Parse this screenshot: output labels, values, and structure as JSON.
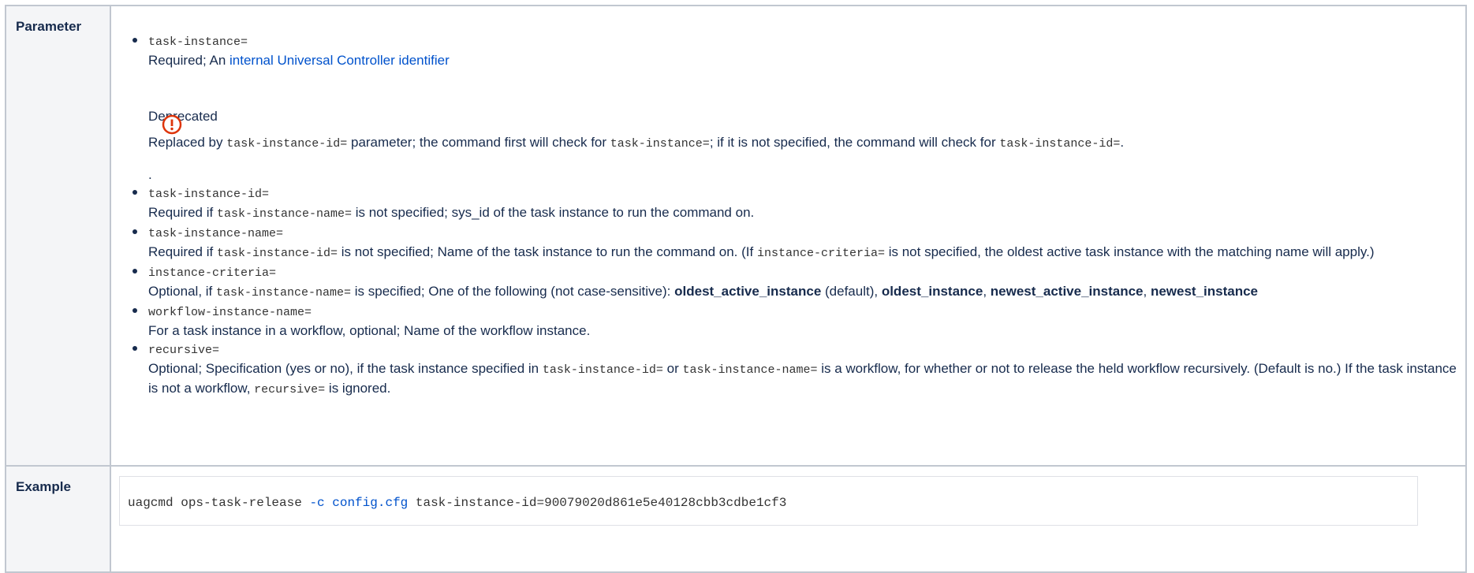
{
  "table": {
    "row1_header": "Parameter",
    "row2_header": "Example"
  },
  "params": [
    {
      "code": "task-instance=",
      "desc_pre": "Required; An ",
      "link": "internal Universal Controller identifier",
      "deprecated_title": "Deprecated",
      "deprecated": {
        "t1": "Replaced by ",
        "c1": "task-instance-id=",
        "t2": " parameter; the command first will check for ",
        "c2": "task-instance=",
        "t3": "; if it is not specified, the command will check for ",
        "c3": "task-instance-id=",
        "t4": "."
      },
      "trailing": "."
    },
    {
      "code": "task-instance-id=",
      "t1": "Required if ",
      "c1": "task-instance-name=",
      "t2": " is not specified; sys_id of the task instance to run the command on."
    },
    {
      "code": "task-instance-name=",
      "t1": "Required if ",
      "c1": "task-instance-id=",
      "t2": " is not specified; Name of the task instance to run the command on. (If ",
      "c2": "instance-criteria=",
      "t3": " is not specified, the oldest active task instance with the matching name will apply.)"
    },
    {
      "code": "instance-criteria=",
      "t1": "Optional, if ",
      "c1": "task-instance-name=",
      "t2": " is specified; One of the following (not case-sensitive): ",
      "b1": "oldest_active_instance",
      "t3": " (default), ",
      "b2": "oldest_instance",
      "t4": ", ",
      "b3": "newest_active_instance",
      "t5": ", ",
      "b4": "newest_instance"
    },
    {
      "code": "workflow-instance-name=",
      "t1": "For a task instance in a workflow, optional; Name of the workflow instance."
    },
    {
      "code": "recursive=",
      "t1": "Optional; Specification (yes or no), if the task instance specified in ",
      "c1": "task-instance-id=",
      "t2": " or ",
      "c2": "task-instance-name=",
      "t3": " is a workflow, for whether or not to release the held workflow recursively. (Default is no.) If the task instance is not a workflow, ",
      "c3": "recursive=",
      "t4": " is ignored."
    }
  ],
  "example": {
    "cmd": "uagcmd ops-task-release ",
    "flag": "-c",
    "space": " ",
    "cfg": "config.cfg",
    "rest": " task-instance-id=90079020d861e5e40128cbb3cdbe1cf3"
  },
  "icons": {
    "warning": "exclamation-circle-icon",
    "warning_color": "#de350b"
  }
}
